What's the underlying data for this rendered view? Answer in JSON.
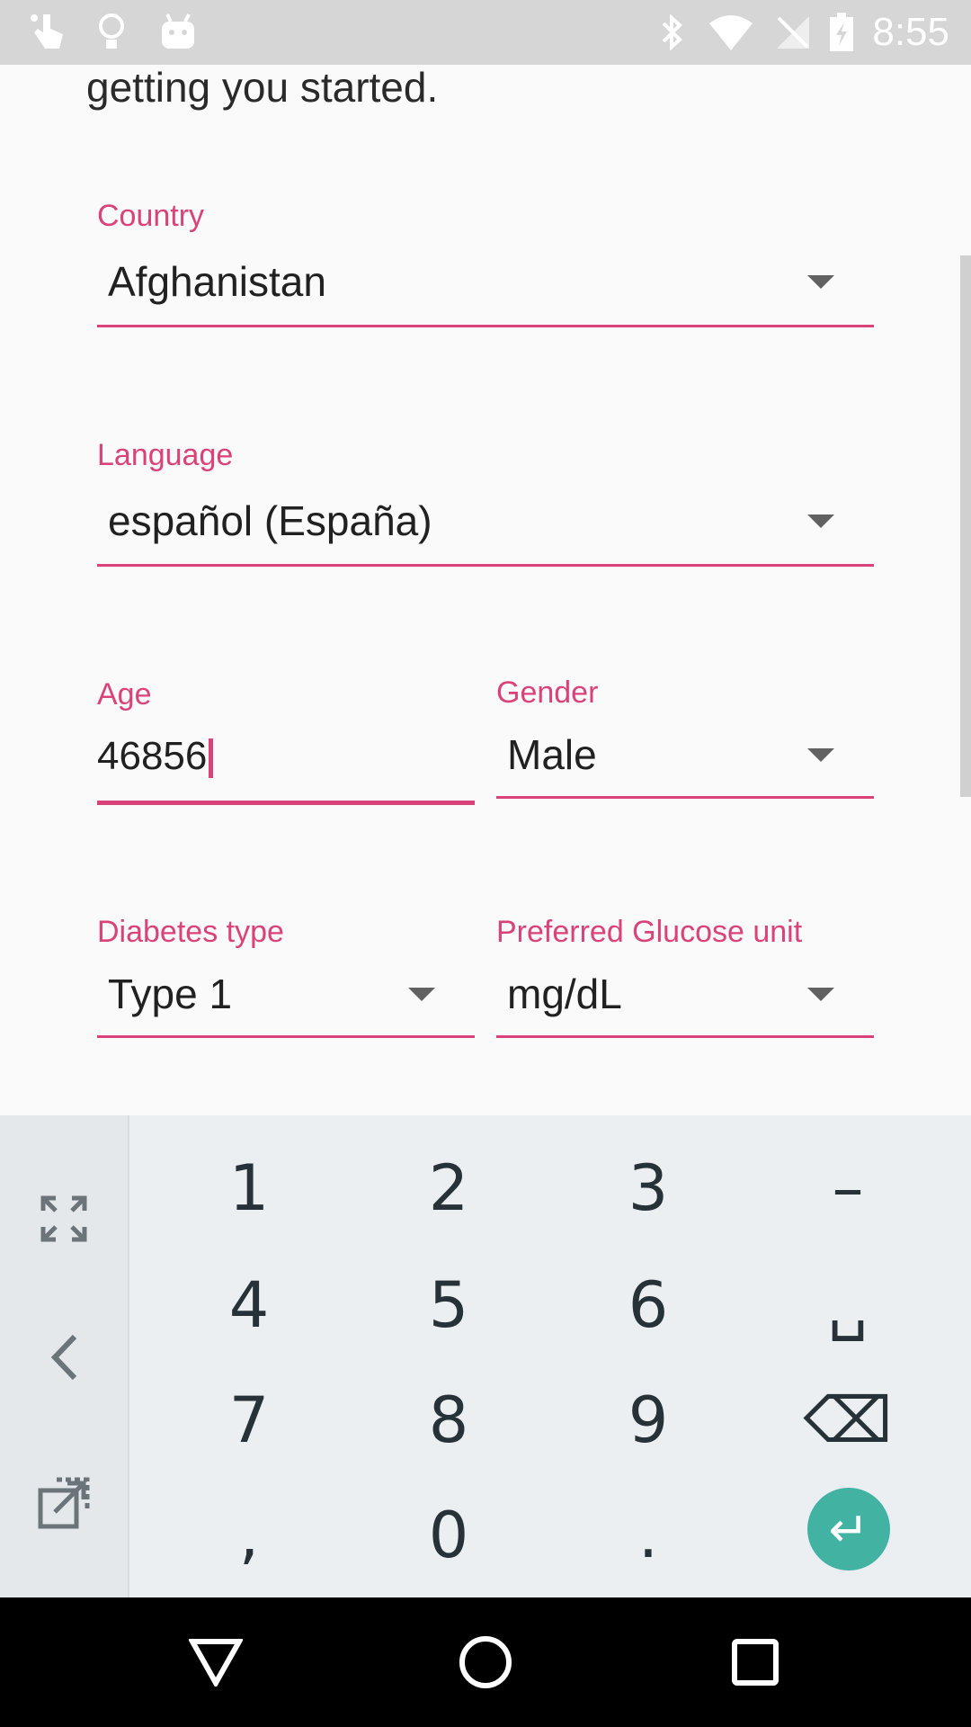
{
  "status_bar": {
    "time": "8:55",
    "left_icons": [
      "touch-icon",
      "lightbulb-icon",
      "android-icon"
    ],
    "right_icons": [
      "bluetooth-icon",
      "wifi-icon",
      "no-signal-icon",
      "battery-charging-icon"
    ]
  },
  "form": {
    "intro_text": "getting you started.",
    "country": {
      "label": "Country",
      "value": "Afghanistan"
    },
    "language": {
      "label": "Language",
      "value": "español (España)"
    },
    "age": {
      "label": "Age",
      "value": "46856"
    },
    "gender": {
      "label": "Gender",
      "value": "Male"
    },
    "diabetes_type": {
      "label": "Diabetes type",
      "value": "Type 1"
    },
    "glucose_unit": {
      "label": "Preferred Glucose unit",
      "value": "mg/dL"
    }
  },
  "keyboard": {
    "keys": [
      [
        "1",
        "2",
        "3",
        "–"
      ],
      [
        "4",
        "5",
        "6",
        "␣"
      ],
      [
        "7",
        "8",
        "9",
        "⌫"
      ],
      [
        ",",
        "0",
        ".",
        "↵"
      ]
    ],
    "side_icons": [
      "expand-icon",
      "back-arrow-icon",
      "external-edit-icon"
    ]
  },
  "nav_bar": {
    "icons": [
      "back-triangle-icon",
      "home-circle-icon",
      "recents-square-icon"
    ]
  },
  "colors": {
    "accent": "#d9437a",
    "enter": "#42b2a3",
    "status_bar": "#d6d6d6"
  }
}
